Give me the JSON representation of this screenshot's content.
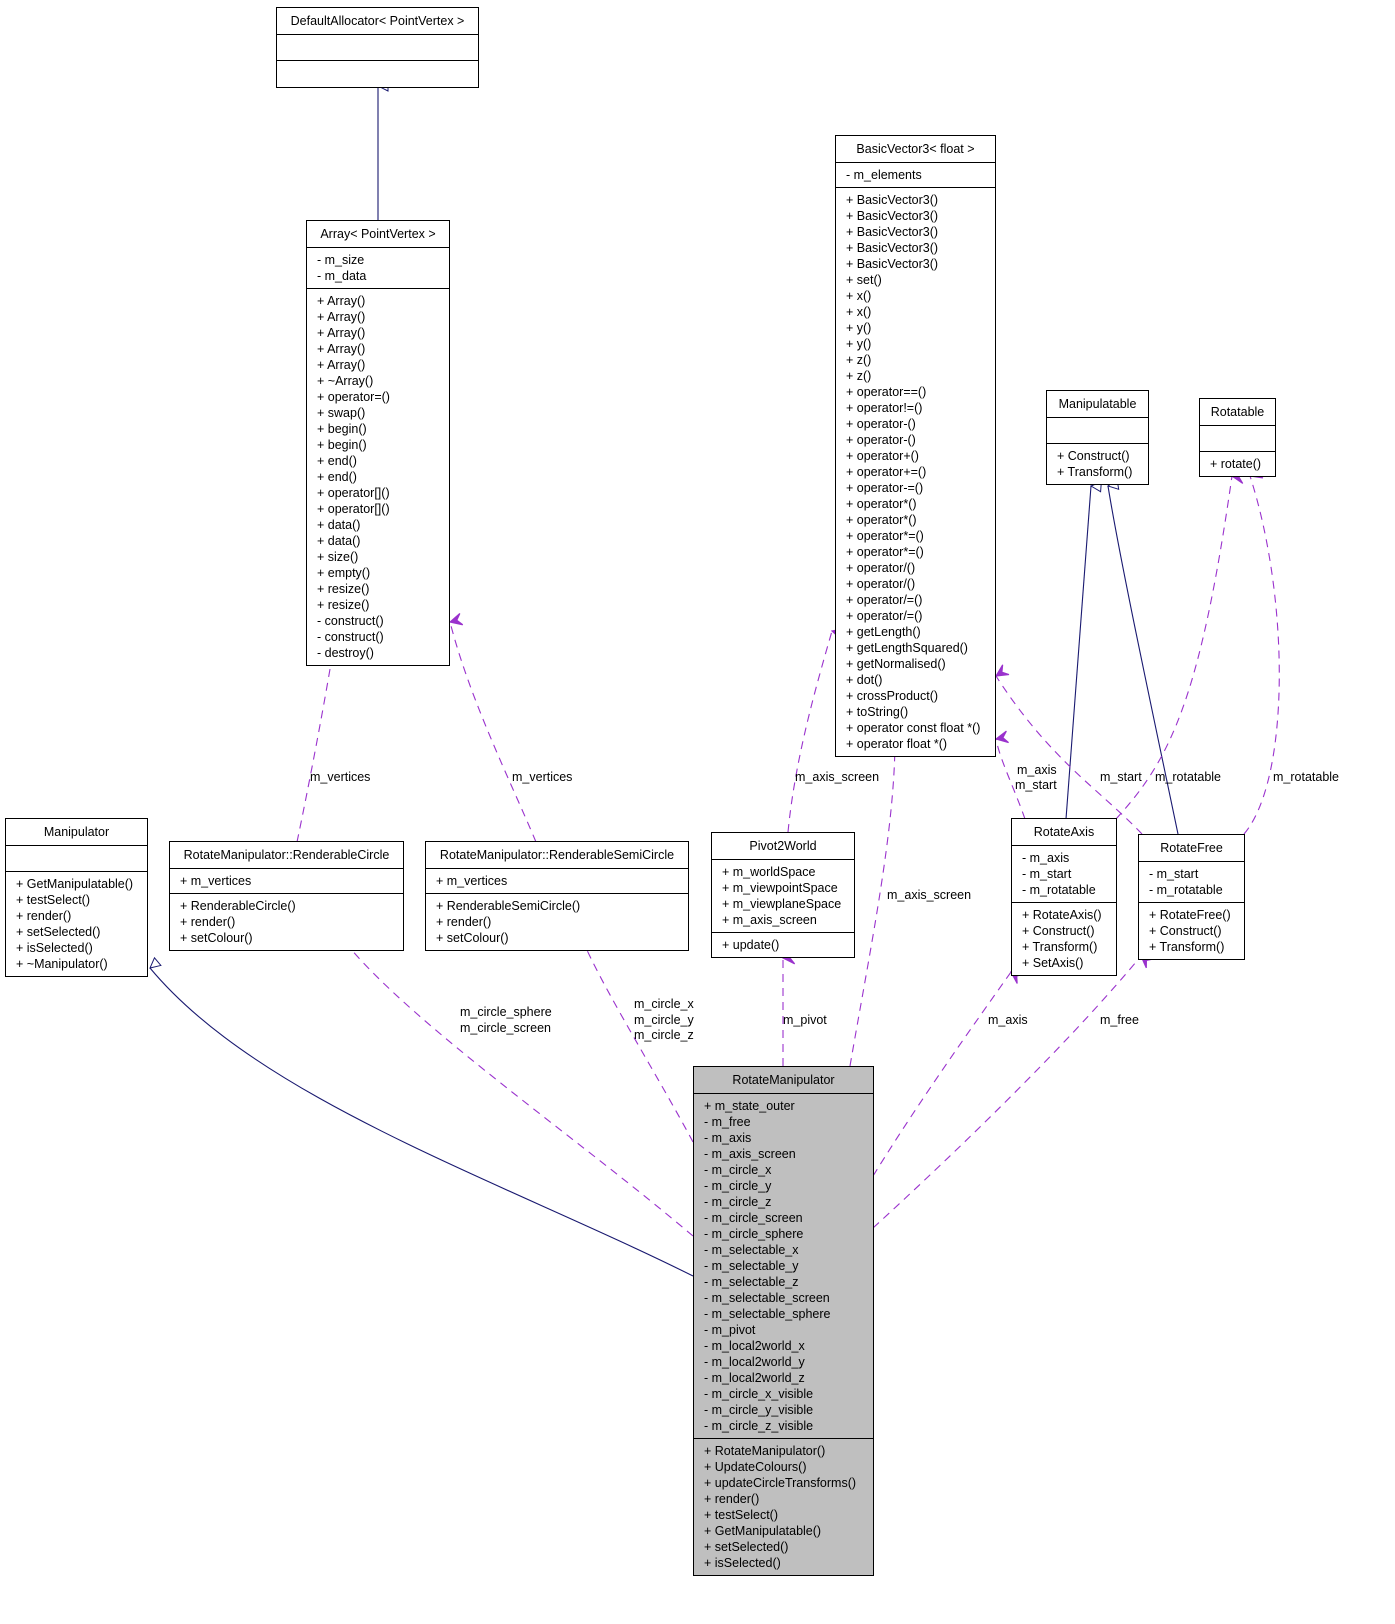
{
  "diagram": {
    "type": "uml-collaboration",
    "colors": {
      "inheritance_edge": "#191970",
      "usage_edge": "#9a32cd",
      "highlight_fill": "#bfbfbf",
      "box_fill": "#ffffff"
    },
    "classes": {
      "default_allocator": {
        "name": "DefaultAllocator< PointVertex >",
        "attributes": [],
        "methods": []
      },
      "array": {
        "name": "Array< PointVertex >",
        "attributes": [
          "- m_size",
          "- m_data"
        ],
        "methods": [
          "+ Array()",
          "+ Array()",
          "+ Array()",
          "+ Array()",
          "+ Array()",
          "+ ~Array()",
          "+ operator=()",
          "+ swap()",
          "+ begin()",
          "+ begin()",
          "+ end()",
          "+ end()",
          "+ operator[]()",
          "+ operator[]()",
          "+ data()",
          "+ data()",
          "+ size()",
          "+ empty()",
          "+ resize()",
          "+ resize()",
          "- construct()",
          "- construct()",
          "- destroy()"
        ]
      },
      "basic_vector3": {
        "name": "BasicVector3< float >",
        "attributes": [
          "- m_elements"
        ],
        "methods": [
          "+ BasicVector3()",
          "+ BasicVector3()",
          "+ BasicVector3()",
          "+ BasicVector3()",
          "+ BasicVector3()",
          "+ set()",
          "+ x()",
          "+ x()",
          "+ y()",
          "+ y()",
          "+ z()",
          "+ z()",
          "+ operator==()",
          "+ operator!=()",
          "+ operator-()",
          "+ operator-()",
          "+ operator+()",
          "+ operator+=()",
          "+ operator-=()",
          "+ operator*()",
          "+ operator*()",
          "+ operator*=()",
          "+ operator*=()",
          "+ operator/()",
          "+ operator/()",
          "+ operator/=()",
          "+ operator/=()",
          "+ getLength()",
          "+ getLengthSquared()",
          "+ getNormalised()",
          "+ dot()",
          "+ crossProduct()",
          "+ toString()",
          "+ operator const float *()",
          "+ operator float *()"
        ]
      },
      "manipulatable": {
        "name": "Manipulatable",
        "attributes": [],
        "methods": [
          "+ Construct()",
          "+ Transform()"
        ]
      },
      "rotatable": {
        "name": "Rotatable",
        "attributes": [],
        "methods": [
          "+ rotate()"
        ]
      },
      "manipulator": {
        "name": "Manipulator",
        "attributes": [],
        "methods": [
          "+ GetManipulatable()",
          "+ testSelect()",
          "+ render()",
          "+ setSelected()",
          "+ isSelected()",
          "+ ~Manipulator()"
        ]
      },
      "renderable_circle": {
        "name": "RotateManipulator::RenderableCircle",
        "attributes": [
          "+ m_vertices"
        ],
        "methods": [
          "+ RenderableCircle()",
          "+ render()",
          "+ setColour()"
        ]
      },
      "renderable_semicircle": {
        "name": "RotateManipulator::RenderableSemiCircle",
        "attributes": [
          "+ m_vertices"
        ],
        "methods": [
          "+ RenderableSemiCircle()",
          "+ render()",
          "+ setColour()"
        ]
      },
      "pivot2world": {
        "name": "Pivot2World",
        "attributes": [
          "+ m_worldSpace",
          "+ m_viewpointSpace",
          "+ m_viewplaneSpace",
          "+ m_axis_screen"
        ],
        "methods": [
          "+ update()"
        ]
      },
      "rotate_axis": {
        "name": "RotateAxis",
        "attributes": [
          "- m_axis",
          "- m_start",
          "- m_rotatable"
        ],
        "methods": [
          "+ RotateAxis()",
          "+ Construct()",
          "+ Transform()",
          "+ SetAxis()"
        ]
      },
      "rotate_free": {
        "name": "RotateFree",
        "attributes": [
          "- m_start",
          "- m_rotatable"
        ],
        "methods": [
          "+ RotateFree()",
          "+ Construct()",
          "+ Transform()"
        ]
      },
      "rotate_manipulator": {
        "name": "RotateManipulator",
        "attributes": [
          "+ m_state_outer",
          "- m_free",
          "- m_axis",
          "- m_axis_screen",
          "- m_circle_x",
          "- m_circle_y",
          "- m_circle_z",
          "- m_circle_screen",
          "- m_circle_sphere",
          "- m_selectable_x",
          "- m_selectable_y",
          "- m_selectable_z",
          "- m_selectable_screen",
          "- m_selectable_sphere",
          "- m_pivot",
          "- m_local2world_x",
          "- m_local2world_y",
          "- m_local2world_z",
          "- m_circle_x_visible",
          "- m_circle_y_visible",
          "- m_circle_z_visible"
        ],
        "methods": [
          "+ RotateManipulator()",
          "+ UpdateColours()",
          "+ updateCircleTransforms()",
          "+ render()",
          "+ testSelect()",
          "+ GetManipulatable()",
          "+ setSelected()",
          "+ isSelected()"
        ]
      }
    },
    "edge_labels": {
      "array_vertices_circle": "m_vertices",
      "array_vertices_semicircle": "m_vertices",
      "vec_axis_screen_pivot": "m_axis_screen",
      "vec_axis_screen_rm": "m_axis_screen",
      "vec_axis_start_1": "m_axis",
      "vec_axis_start_2": "m_start",
      "vec_start_free": "m_start",
      "rot_rotatable_axis": "m_rotatable",
      "rot_rotatable_free": "m_rotatable",
      "circle_1": "m_circle_sphere",
      "circle_2": "m_circle_screen",
      "semi_1": "m_circle_x",
      "semi_2": "m_circle_y",
      "semi_3": "m_circle_z",
      "pivot": "m_pivot",
      "axis": "m_axis",
      "free": "m_free"
    }
  }
}
